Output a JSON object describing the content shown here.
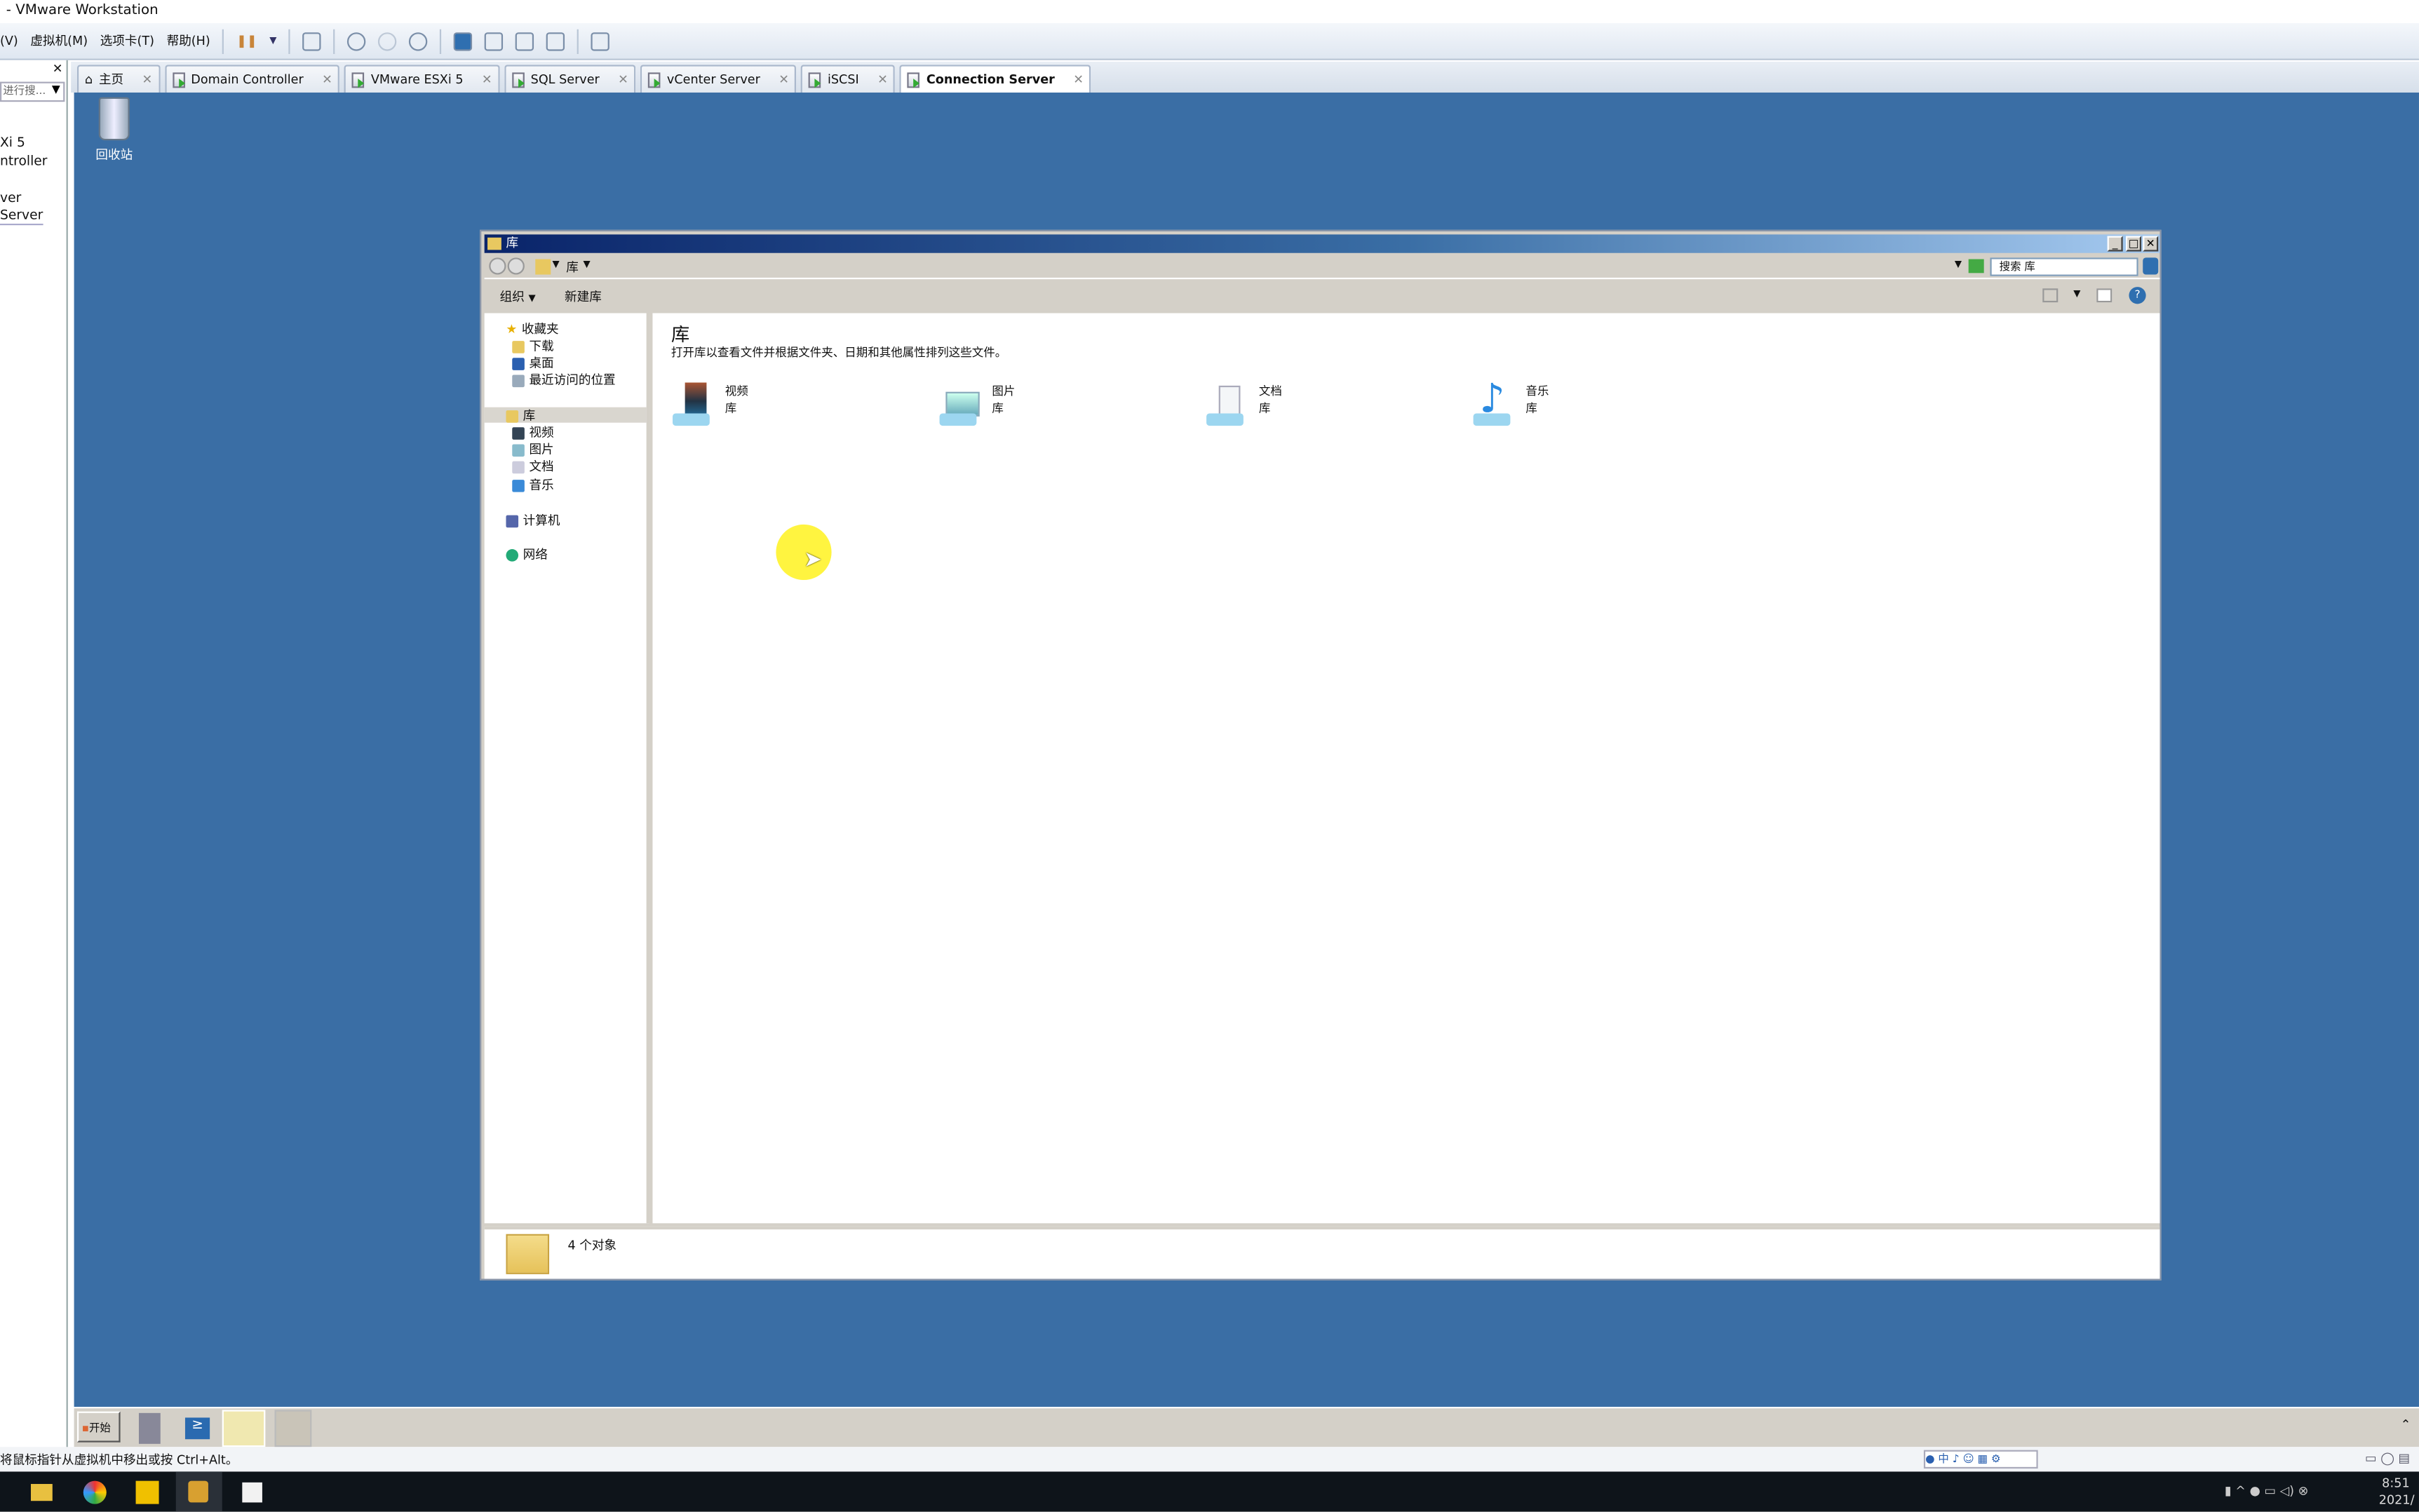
{
  "app": {
    "title": "- VMware Workstation"
  },
  "menu": [
    "(V)",
    "虚拟机(M)",
    "选项卡(T)",
    "帮助(H)"
  ],
  "left_panel": {
    "search_placeholder": "进行搜...",
    "items": [
      "Xi 5",
      "ntroller",
      "ver",
      "Server"
    ]
  },
  "tabs": [
    {
      "label": "主页",
      "icon": "home-icon"
    },
    {
      "label": "Domain Controller"
    },
    {
      "label": "VMware ESXi 5"
    },
    {
      "label": "SQL Server"
    },
    {
      "label": "vCenter Server"
    },
    {
      "label": "iSCSI"
    },
    {
      "label": "Connection Server",
      "active": true
    }
  ],
  "desktop": {
    "recycle_bin": "回收站",
    "background": "#3a6ea5"
  },
  "explorer": {
    "title": "库",
    "breadcrumb": "库",
    "search_placeholder": "搜索 库",
    "commands": {
      "organize": "组织",
      "new_library": "新建库"
    },
    "nav": {
      "favorites": "收藏夹",
      "fav_items": [
        "下载",
        "桌面",
        "最近访问的位置"
      ],
      "libraries": "库",
      "lib_items": [
        "视频",
        "图片",
        "文档",
        "音乐"
      ],
      "computer": "计算机",
      "network": "网络"
    },
    "heading": "库",
    "description": "打开库以查看文件并根据文件夹、日期和其他属性排列这些文件。",
    "libraries": [
      {
        "name": "视频",
        "type": "库"
      },
      {
        "name": "图片",
        "type": "库"
      },
      {
        "name": "文档",
        "type": "库"
      },
      {
        "name": "音乐",
        "type": "库"
      }
    ],
    "status": "4 个对象"
  },
  "guest_taskbar": {
    "start": "开始"
  },
  "vm_status": {
    "hint": "将鼠标指针从虚拟机中移出或按 Ctrl+Alt。"
  },
  "host_taskbar": {
    "time": "8:51",
    "date": "2021/"
  }
}
